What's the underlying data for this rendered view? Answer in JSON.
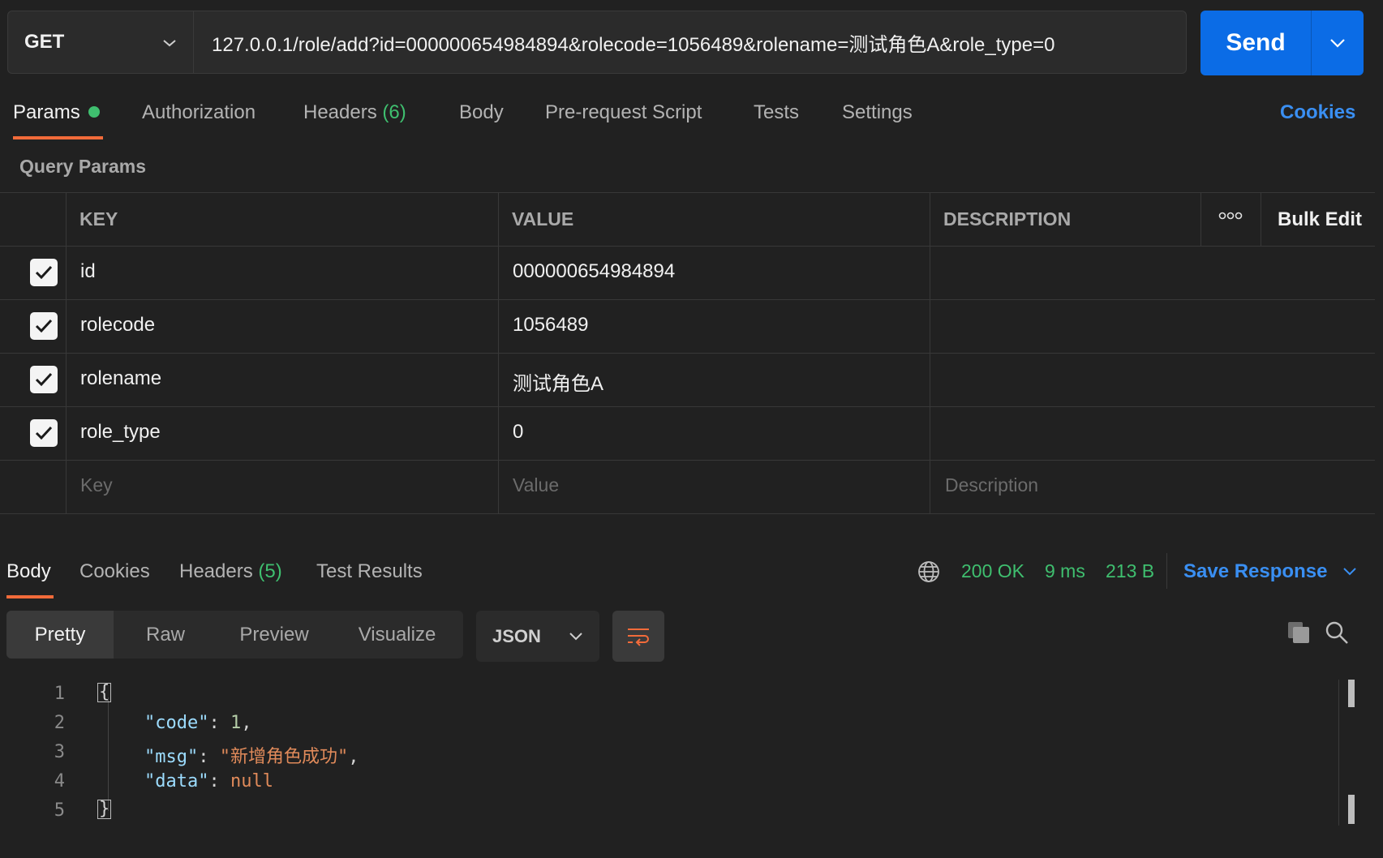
{
  "request": {
    "method": "GET",
    "url": "127.0.0.1/role/add?id=000000654984894&rolecode=1056489&rolename=测试角色A&role_type=0",
    "send_label": "Send"
  },
  "tabs": {
    "params": "Params",
    "authorization": "Authorization",
    "headers": "Headers",
    "headers_count": "(6)",
    "body": "Body",
    "pre_request": "Pre-request Script",
    "tests": "Tests",
    "settings": "Settings",
    "cookies": "Cookies"
  },
  "query_params": {
    "title": "Query Params",
    "columns": {
      "key": "KEY",
      "value": "VALUE",
      "description": "DESCRIPTION"
    },
    "bulk_edit": "Bulk Edit",
    "rows": [
      {
        "key": "id",
        "value": "000000654984894",
        "checked": true
      },
      {
        "key": "rolecode",
        "value": "1056489",
        "checked": true
      },
      {
        "key": "rolename",
        "value": "测试角色A",
        "checked": true
      },
      {
        "key": "role_type",
        "value": "0",
        "checked": true
      }
    ],
    "placeholders": {
      "key": "Key",
      "value": "Value",
      "description": "Description"
    }
  },
  "response": {
    "tabs": {
      "body": "Body",
      "cookies": "Cookies",
      "headers": "Headers",
      "headers_count": "(5)",
      "test_results": "Test Results"
    },
    "status": "200 OK",
    "time": "9 ms",
    "size": "213 B",
    "save_response": "Save Response",
    "views": {
      "pretty": "Pretty",
      "raw": "Raw",
      "preview": "Preview",
      "visualize": "Visualize"
    },
    "format": "JSON",
    "lines": [
      "1",
      "2",
      "3",
      "4",
      "5"
    ],
    "body_json": {
      "open": "{",
      "code_key": "\"code\"",
      "code_val": "1",
      "msg_key": "\"msg\"",
      "msg_val": "\"新增角色成功\"",
      "data_key": "\"data\"",
      "data_val": "null",
      "close": "}"
    }
  },
  "colors": {
    "accent_orange": "#f26b3a",
    "send_blue": "#0b6ce6",
    "link_blue": "#3a8ff2",
    "success_green": "#3fbf6f"
  }
}
